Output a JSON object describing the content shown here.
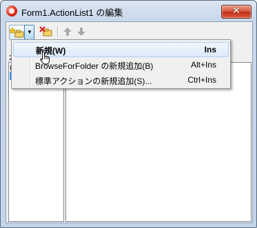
{
  "window": {
    "title": "Form1.ActionList1 の編集",
    "close_label": "✕"
  },
  "toolbar": {
    "new_icon": "new-action-icon",
    "dropdown_glyph": "▼",
    "delete_icon": "delete-action-icon",
    "up_icon": "move-up-arrow-icon",
    "down_icon": "move-down-arrow-icon"
  },
  "left_pane": {
    "label_fragment": "カ",
    "row_fragment": "("
  },
  "context_menu": {
    "items": [
      {
        "label": "新規(W)",
        "shortcut": "Ins"
      },
      {
        "label": "BrowseForFolder の新規追加(B)",
        "shortcut": "Alt+Ins"
      },
      {
        "label": "標準アクションの新規追加(S)...",
        "shortcut": "Ctrl+Ins"
      }
    ]
  },
  "colors": {
    "accent": "#3399ff",
    "menu_highlight": "#dbeafb",
    "close_button": "#c22d16"
  }
}
